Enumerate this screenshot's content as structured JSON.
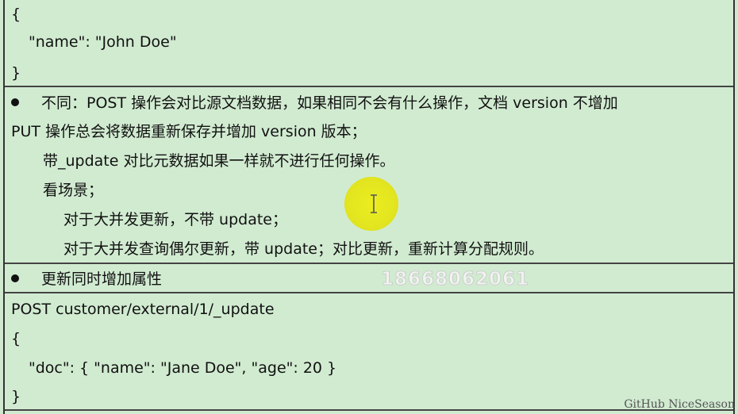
{
  "block1": {
    "open": "{",
    "name_line": "\"name\": \"John Doe\"",
    "close": "}"
  },
  "block2": {
    "line1": "不同：POST 操作会对比源文档数据，如果相同不会有什么操作，文档 version 不增加",
    "line2": "PUT 操作总会将数据重新保存并增加 version 版本；",
    "line3": "带_update 对比元数据如果一样就不进行任何操作。",
    "line4": "看场景；",
    "line5": "对于大并发更新，不带 update；",
    "line6": "对于大并发查询偶尔更新，带 update；对比更新，重新计算分配规则。"
  },
  "block3": {
    "title": "更新同时增加属性"
  },
  "block4": {
    "request": "POST customer/external/1/_update",
    "open": "{",
    "doc_line": "\"doc\": { \"name\": \"Jane Doe\", \"age\": 20 }",
    "close": "}"
  },
  "watermark": "18668062061",
  "footer": "GitHub NiceSeason",
  "cursor_icon": "text-cursor-icon",
  "colors": {
    "background": "#d1ebd1",
    "highlight": "#e6e400"
  }
}
